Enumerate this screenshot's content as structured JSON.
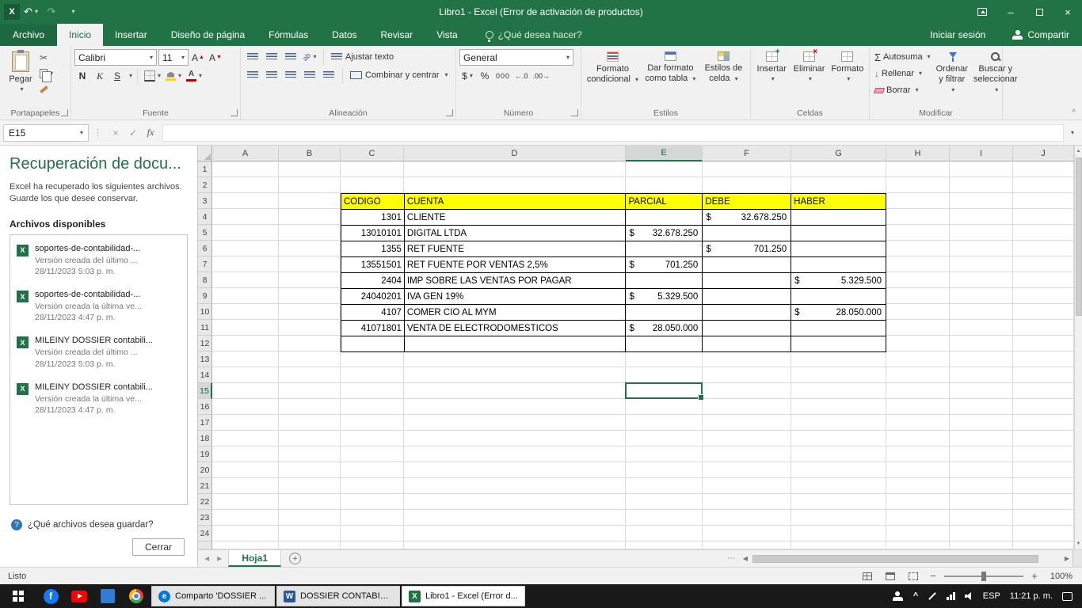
{
  "title_bar": {
    "title": "Libro1 - Excel (Error de activación de productos)"
  },
  "ribbon_tabs": {
    "file": "Archivo",
    "tabs": [
      "Inicio",
      "Insertar",
      "Diseño de página",
      "Fórmulas",
      "Datos",
      "Revisar",
      "Vista"
    ],
    "active": "Inicio",
    "tell_me": "¿Qué desea hacer?",
    "sign_in": "Iniciar sesión",
    "share": "Compartir"
  },
  "ribbon": {
    "clipboard": {
      "label": "Portapapeles",
      "paste": "Pegar"
    },
    "font": {
      "label": "Fuente",
      "name": "Calibri",
      "size": "11",
      "bold": "N",
      "italic": "K",
      "underline": "S"
    },
    "alignment": {
      "label": "Alineación",
      "wrap_text": "Ajustar texto",
      "merge_center": "Combinar y centrar"
    },
    "number": {
      "label": "Número",
      "format": "General",
      "currency": "$",
      "percent": "%",
      "thousands": "000"
    },
    "styles": {
      "label": "Estilos",
      "conditional": "Formato condicional",
      "format_table": "Dar formato como tabla",
      "cell_styles": "Estilos de celda"
    },
    "cells": {
      "label": "Celdas",
      "insert": "Insertar",
      "delete": "Eliminar",
      "format": "Formato"
    },
    "editing": {
      "label": "Modificar",
      "autosum": "Autosuma",
      "fill": "Rellenar",
      "clear": "Borrar",
      "sort": "Ordenar y filtrar",
      "find": "Buscar y seleccionar"
    }
  },
  "formula_bar": {
    "name_box": "E15",
    "formula": ""
  },
  "recovery_pane": {
    "title": "Recuperación de docu...",
    "intro": "Excel ha recuperado los siguientes archivos. Guarde los que desee conservar.",
    "files_heading": "Archivos disponibles",
    "files": [
      {
        "name": "soportes-de-contabilidad-...",
        "version": "Versión creada del último ...",
        "date": "28/11/2023 5:03 p. m."
      },
      {
        "name": "soportes-de-contabilidad-...",
        "version": "Versión creada la última ve...",
        "date": "28/11/2023 4:47 p. m."
      },
      {
        "name": "MILEINY DOSSIER contabili...",
        "version": "Versión creada del último ...",
        "date": "28/11/2023 5:03 p. m."
      },
      {
        "name": "MILEINY DOSSIER contabili...",
        "version": "Versión creada la última ve...",
        "date": "28/11/2023 4:47 p. m."
      }
    ],
    "question": "¿Qué archivos desea guardar?",
    "close": "Cerrar"
  },
  "grid": {
    "columns": [
      "A",
      "B",
      "C",
      "D",
      "E",
      "F",
      "G",
      "H",
      "I",
      "J"
    ],
    "visible_rows": 24,
    "selected": {
      "col": "E",
      "row": 15
    },
    "table_range": {
      "first_row": 3,
      "last_row": 12,
      "first_col": "C",
      "last_col": "G"
    },
    "cells": [
      {
        "r": 3,
        "c": "C",
        "t": "CODIGO",
        "k": "head"
      },
      {
        "r": 3,
        "c": "D",
        "t": "CUENTA",
        "k": "head"
      },
      {
        "r": 3,
        "c": "E",
        "t": "PARCIAL",
        "k": "head"
      },
      {
        "r": 3,
        "c": "F",
        "t": "DEBE",
        "k": "head"
      },
      {
        "r": 3,
        "c": "G",
        "t": "HABER",
        "k": "head"
      },
      {
        "r": 4,
        "c": "C",
        "t": "1301",
        "k": "num"
      },
      {
        "r": 4,
        "c": "D",
        "t": "CLIENTE"
      },
      {
        "r": 4,
        "c": "F",
        "cur": "$",
        "amt": "32.678.250"
      },
      {
        "r": 5,
        "c": "C",
        "t": "13010101",
        "k": "num"
      },
      {
        "r": 5,
        "c": "D",
        "t": "DIGITAL LTDA"
      },
      {
        "r": 5,
        "c": "E",
        "cur": "$",
        "amt": "32.678.250"
      },
      {
        "r": 6,
        "c": "C",
        "t": "1355",
        "k": "num"
      },
      {
        "r": 6,
        "c": "D",
        "t": "RET FUENTE"
      },
      {
        "r": 6,
        "c": "F",
        "cur": "$",
        "amt": "701.250"
      },
      {
        "r": 7,
        "c": "C",
        "t": "13551501",
        "k": "num"
      },
      {
        "r": 7,
        "c": "D",
        "t": "RET FUENTE POR VENTAS 2,5%"
      },
      {
        "r": 7,
        "c": "E",
        "cur": "$",
        "amt": "701.250"
      },
      {
        "r": 8,
        "c": "C",
        "t": "2404",
        "k": "num"
      },
      {
        "r": 8,
        "c": "D",
        "t": "IMP SOBRE LAS VENTAS POR PAGAR"
      },
      {
        "r": 8,
        "c": "G",
        "cur": "$",
        "amt": "5.329.500"
      },
      {
        "r": 9,
        "c": "C",
        "t": "24040201",
        "k": "num"
      },
      {
        "r": 9,
        "c": "D",
        "t": "IVA GEN 19%"
      },
      {
        "r": 9,
        "c": "E",
        "cur": "$",
        "amt": "5.329.500"
      },
      {
        "r": 10,
        "c": "C",
        "t": "4107",
        "k": "num"
      },
      {
        "r": 10,
        "c": "D",
        "t": "COMER CIO AL MYM"
      },
      {
        "r": 10,
        "c": "G",
        "cur": "$",
        "amt": "28.050.000"
      },
      {
        "r": 11,
        "c": "C",
        "t": "41071801",
        "k": "num"
      },
      {
        "r": 11,
        "c": "D",
        "t": "VENTA DE ELECTRODOMESTICOS"
      },
      {
        "r": 11,
        "c": "E",
        "cur": "$",
        "amt": "28.050.000"
      }
    ]
  },
  "sheet_tabs": {
    "active": "Hoja1"
  },
  "status_bar": {
    "mode": "Listo",
    "zoom": "100%"
  },
  "taskbar": {
    "windows": [
      {
        "app": "edge",
        "label": "Comparto 'DOSSIER ..."
      },
      {
        "app": "word",
        "label": "DOSSIER CONTABILID..."
      },
      {
        "app": "excel",
        "label": "Libro1 - Excel (Error d...",
        "active": true
      }
    ],
    "language": "ESP",
    "time": "11:21 p. m."
  },
  "icons": {
    "dropdown": "▾",
    "undo": "↶",
    "redo": "↷",
    "close": "×",
    "minimize": "–",
    "scissors": "✂",
    "sigma": "Σ",
    "check": "✓",
    "cross": "×",
    "fx": "fx",
    "chevron_up": "^",
    "left": "◀",
    "right": "▶",
    "up": "▲",
    "down": "▼",
    "plus": "+",
    "minus": "−",
    "ellipsis": "⋯",
    "dots": "⋮",
    "letter_a": "A",
    "orientation": "ab",
    "down_arrow": "↓",
    "inc_decimal": "←.0",
    "dec_decimal": ".00→",
    "edge": "e",
    "word": "W",
    "excel": "X",
    "facebook_f": "f",
    "help": "?"
  },
  "colors": {
    "excel_green": "#217346",
    "header_yellow": "#FFFF00",
    "selection_green": "#217346",
    "taskbar_dark": "#191919"
  }
}
